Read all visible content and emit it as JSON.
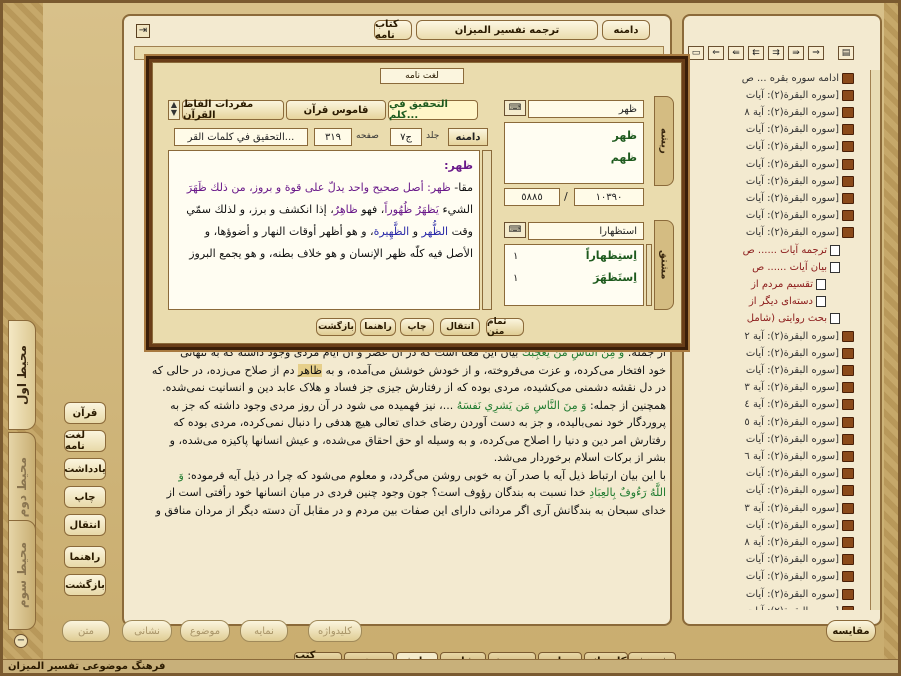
{
  "app": {
    "status_title": "فرهنگ موضوعی تفسیر المیزان"
  },
  "header": {
    "section_label": "دامنه",
    "title": "ترجمه تفسیر المیزان",
    "book_button": "کتاب نامه"
  },
  "left_tabs": [
    "محیط اول",
    "محیط دوم",
    "محیط سوم"
  ],
  "left_buttons": [
    "قرآن",
    "لغت نامه",
    "یادداشت",
    "چاپ",
    "انتقال",
    "راهنما",
    "بازگشت"
  ],
  "bottom_main_buttons": [
    "متن",
    "نشانی",
    "موضوع",
    "نمایه",
    "کلیدواژه"
  ],
  "compare_button": "مقایسه",
  "bottom_tabs": [
    "پژوهش",
    "کلیدواژه",
    "نمایه",
    "موضوع",
    "نشانی",
    "نمایش",
    "جستجو",
    "کتب مرتبط"
  ],
  "main_text": {
    "l1_pre": "از جمله:",
    "l1_q": "وَ مِنَ النَّاسِ مَن يُعجِبُكَ",
    "l1_post": "بیان این معنا است که در آن عصر و آن ایام مردی وجود داشته که به تنهائی",
    "l2": "خود افتخار می‌کرده، و عزت می‌فروخته، و از خودش خوشش می‌آمده، و به",
    "l2_hl": "ظاهر",
    "l2_post": "دم از صلاح می‌زده، در حالی که",
    "l3": "در دل نقشه دشمنی می‌کشیده، مردی بوده که از رفتارش جیزی جز فساد و هلاک عابد دین و انسانیت نمی‌شده.",
    "l4_pre": "همچنین از جمله:",
    "l4_q": "وَ مِنَ النَّاسِ مَن يَشرِي نَفسَهُ",
    "l4_post": "...، نیز فهمیده می شود در آن روز مردی وجود داشته که جز به",
    "l5": "پروردگار خود نمی‌بالیده، و جز به دست آوردن رضای خدای تعالی هیچ هدفی را دنبال نمی‌کرده، مردی بوده که",
    "l6": "رفتارش امر دین و دنیا را اصلاح می‌کرده، و به وسیله او حق احقاق می‌شده، و عیش انسانها پاکیزه می‌شده، و",
    "l7": "بشر از برکات اسلام برخوردار می‌شد.",
    "l8": "با این بیان ارتباط ذیل آیه با صدر آن به خوبی روشن می‌گردد، و معلوم می‌شود که چرا در ذیل آیه فرموده:",
    "l8_q": "وَ",
    "l9_q": "اللَّهُ رَءُوفٌ بِالعِبَادِ",
    "l9_post": "خدا نسبت به بندگان رؤوف است؟ جون وجود چنین فردی در میان انسانها خود رأفتی است از",
    "l10": "خدای سبحان به بندگانش آری اگر مردانی دارای این صفات بین مردم و در مقابل آن دسته دیگر از مردان منافق و"
  },
  "tree": {
    "items": [
      {
        "label": "ادامه سوره بقره ... ص",
        "type": "book"
      },
      {
        "label": "[سوره البقرة(٢): آيات",
        "type": "book"
      },
      {
        "label": "[سوره البقرة(٢): آية ٨",
        "type": "book"
      },
      {
        "label": "[سوره البقرة(٢): آيات",
        "type": "book"
      },
      {
        "label": "[سوره البقرة(٢): آيات",
        "type": "book"
      },
      {
        "label": "[سوره البقرة(٢): آيات",
        "type": "book"
      },
      {
        "label": "[سوره البقرة(٢): آيات",
        "type": "book"
      },
      {
        "label": "[سوره البقرة(٢): آيات",
        "type": "book"
      },
      {
        "label": "[سوره البقرة(٢): آيات",
        "type": "book"
      },
      {
        "label": "[سوره البقرة(٢): آيات",
        "type": "book"
      },
      {
        "label": "ترجمه آيات ...... ص",
        "type": "doc"
      },
      {
        "label": "بيان آيات ...... ص",
        "type": "doc"
      },
      {
        "label": "تقسیم مردم از",
        "type": "doc"
      },
      {
        "label": "دسته‌ای دیگر از",
        "type": "doc"
      },
      {
        "label": "بحث روایتی (شامل",
        "type": "doc"
      },
      {
        "label": "[سوره البقرة(٢): آية ٢",
        "type": "book"
      },
      {
        "label": "[سوره البقرة(٢): آيات",
        "type": "book"
      },
      {
        "label": "[سوره البقرة(٢): آيات",
        "type": "book"
      },
      {
        "label": "[سوره البقرة(٢): آية ٣",
        "type": "book"
      },
      {
        "label": "[سوره البقرة(٢): آية ٤",
        "type": "book"
      },
      {
        "label": "[سوره البقرة(٢): آية ٥",
        "type": "book"
      },
      {
        "label": "[سوره البقرة(٢): آيات",
        "type": "book"
      },
      {
        "label": "[سوره البقرة(٢): آية ٦",
        "type": "book"
      },
      {
        "label": "[سوره البقرة(٢): آيات",
        "type": "book"
      },
      {
        "label": "[سوره البقرة(٢): آيات",
        "type": "book"
      },
      {
        "label": "[سوره البقرة(٢): آية ٣",
        "type": "book"
      },
      {
        "label": "[سوره البقرة(٢): آيات",
        "type": "book"
      },
      {
        "label": "[سوره البقرة(٢): آية ٨",
        "type": "book"
      },
      {
        "label": "[سوره البقرة(٢): آيات",
        "type": "book"
      },
      {
        "label": "[سوره البقرة(٢): آيات",
        "type": "book"
      },
      {
        "label": "[سوره البقرة(٢): آيات",
        "type": "book"
      },
      {
        "label": "[سوره البقرة(٢): آيات",
        "type": "book"
      }
    ]
  },
  "dialog": {
    "title": "لغت نامه",
    "book_tabs": [
      "التحقيق في كلم...",
      "قاموس قرآن",
      "مفردات الفاظ القرآن"
    ],
    "domain_button": "دامنه",
    "vol_label": "جلد",
    "vol_value": "ج٧",
    "page_label": "صفحه",
    "page_value": "٣١٩",
    "source_name": "التحقيق في كلمات القر...",
    "article": {
      "head": "ظهر:",
      "l1_a": "مقا-",
      "l1_b": "ظهر: أصل صحيح واحد يدلّ على قوة و بروز، من ذلك",
      "l1_w": "ظَهَرَ",
      "l2_a": "الشيء",
      "l2_w1": "يَظهَرُ ظُهُوراً",
      "l2_b": "، فهو",
      "l2_w2": "ظاهِرٌ",
      "l2_c": "، إذا انكشف و برز، و لذلك سمّي",
      "l3_a": "وقت",
      "l3_w1": "الظُّهر",
      "l3_b": "و",
      "l3_w2": "الظَّهِيرة",
      "l3_c": "، و هو أظهر أوقات النهار و أضوؤها، و",
      "l4": "الأصل فيه كلّه ظهر الإنسان و هو خلاف بطنه، و هو يجمع البروز"
    },
    "root_label": "ريشه",
    "derived_label": "مشتق",
    "root_input": "ظهر",
    "root_list": [
      "ظهر",
      "ظهم"
    ],
    "num_a": "١٠٣٩٠",
    "num_b": "٥٨٨٥",
    "derived_input": "استظهارا",
    "derived_list": [
      {
        "word": "اِستِظهاراً",
        "count": "١"
      },
      {
        "word": "اِستَظهَرَ",
        "count": "١"
      }
    ],
    "buttons": [
      "تمام متن",
      "انتقال",
      "چاپ",
      "راهنما",
      "بازگشت"
    ]
  }
}
